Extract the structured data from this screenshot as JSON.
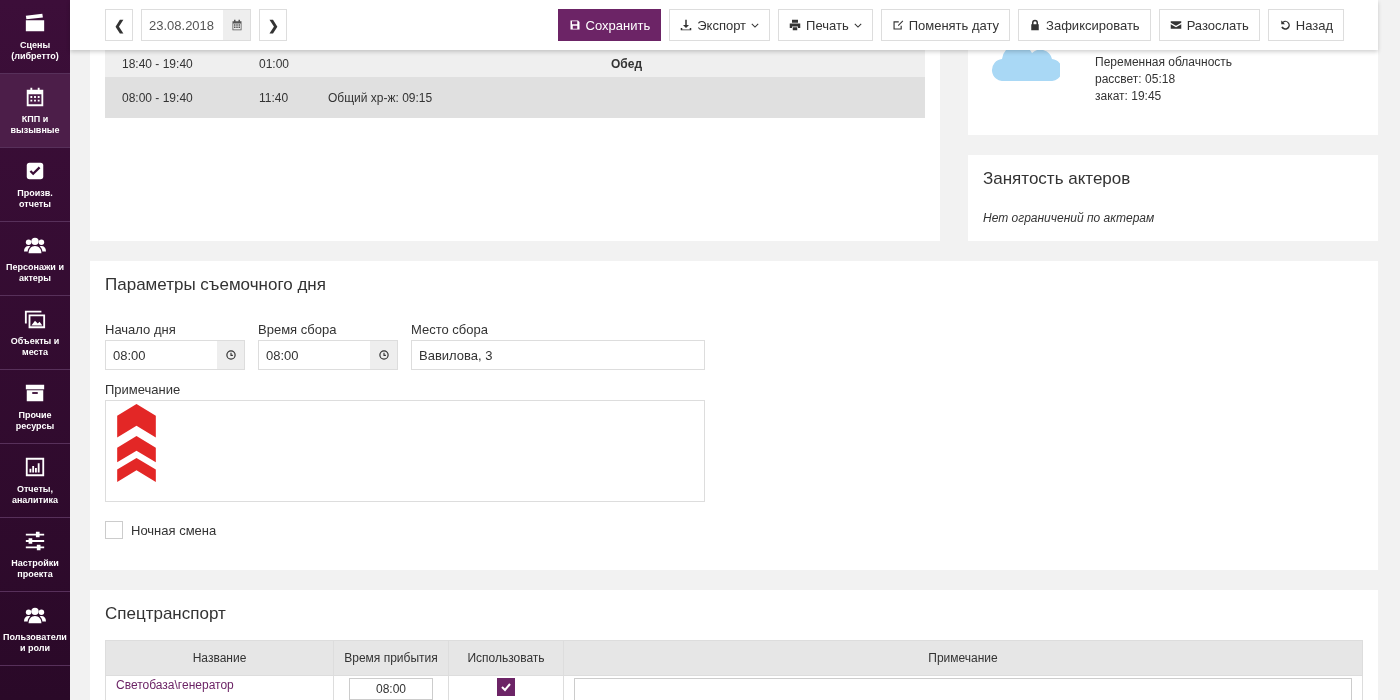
{
  "sidebar": {
    "items": [
      {
        "label": "Сцены (либретто)",
        "selected": false
      },
      {
        "label": "КПП и вызывные",
        "selected": true
      },
      {
        "label": "Произв. отчеты",
        "selected": false
      },
      {
        "label": "Персонажи и актеры",
        "selected": false
      },
      {
        "label": "Объекты и места",
        "selected": false
      },
      {
        "label": "Прочие ресурсы",
        "selected": false
      },
      {
        "label": "Отчеты, аналитика",
        "selected": false
      },
      {
        "label": "Настройки проекта",
        "selected": false
      },
      {
        "label": "Пользователи и роли",
        "selected": false
      }
    ]
  },
  "toolbar": {
    "prev": "❮",
    "date": "23.08.2018",
    "next": "❯",
    "buttons": [
      {
        "label": "Сохранить",
        "primary": true,
        "dropdown": false
      },
      {
        "label": "Экспорт",
        "primary": false,
        "dropdown": true
      },
      {
        "label": "Печать",
        "primary": false,
        "dropdown": true
      },
      {
        "label": "Поменять дату",
        "primary": false,
        "dropdown": false
      },
      {
        "label": "Зафиксировать",
        "primary": false,
        "dropdown": false
      },
      {
        "label": "Разослать",
        "primary": false,
        "dropdown": false
      },
      {
        "label": "Назад",
        "primary": false,
        "dropdown": false
      }
    ]
  },
  "schedule": {
    "rows": [
      {
        "time": "18:40 - 19:40",
        "duration": "01:00",
        "note": "Обед",
        "kind": "break"
      },
      {
        "time": "08:00 - 19:40",
        "duration": "11:40",
        "note": "Общий хр-ж: 09:15",
        "kind": "total"
      }
    ]
  },
  "weather": {
    "lines": [
      "Переменная облачность",
      "рассвет: 05:18",
      "закат: 19:45"
    ]
  },
  "actors": {
    "title": "Занятость актеров",
    "note": "Нет ограничений по актерам"
  },
  "params": {
    "title": "Параметры съемочного дня",
    "fields": [
      {
        "label": "Начало дня",
        "value": "08:00",
        "kind": "time"
      },
      {
        "label": "Время сбора",
        "value": "08:00",
        "kind": "time"
      },
      {
        "label": "Место сбора",
        "value": "Вавилова, 3",
        "kind": "text"
      }
    ],
    "note_label": "Примечание",
    "night_shift": {
      "label": "Ночная смена",
      "checked": false
    }
  },
  "transport": {
    "title": "Спецтранспорт",
    "columns": [
      "Название",
      "Время прибытия",
      "Использовать",
      "Примечание"
    ],
    "rows": [
      {
        "name": "Светобаза\\генератор",
        "time": "08:00",
        "use": true
      }
    ]
  }
}
